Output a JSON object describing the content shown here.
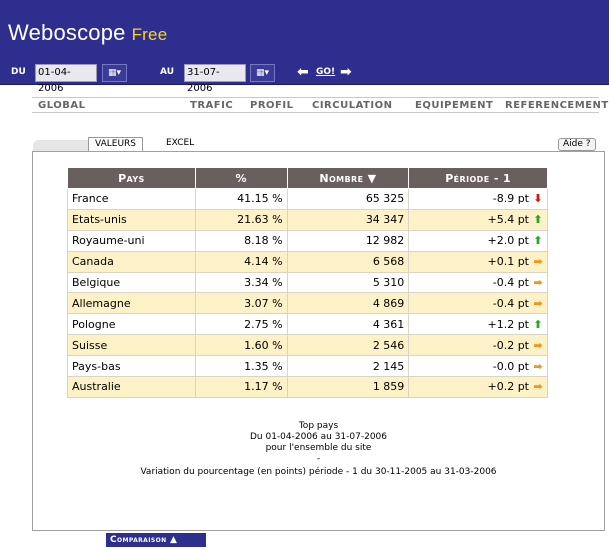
{
  "app": {
    "name": "Weboscope",
    "edition": "Free"
  },
  "dates": {
    "from_label": "DU",
    "from_value": "01-04-2006",
    "to_label": "AU",
    "to_value": "31-07-2006",
    "go_label": "GO!"
  },
  "nav": {
    "items": [
      "GLOBAL",
      "TRAFIC",
      "PROFIL",
      "CIRCULATION",
      "EQUIPEMENT",
      "REFERENCEMENT"
    ]
  },
  "tabs": {
    "valeurs": "VALEURS",
    "excel": "EXCEL",
    "help": "Aide ?"
  },
  "table": {
    "headers": [
      "Pays",
      "%",
      "Nombre ▼",
      "Période - 1"
    ],
    "rows": [
      {
        "pays": "France",
        "pct": "41.15 %",
        "nombre": "65 325",
        "periode": "-8.9 pt",
        "trend": "down"
      },
      {
        "pays": "Etats-unis",
        "pct": "21.63 %",
        "nombre": "34 347",
        "periode": "+5.4 pt",
        "trend": "up"
      },
      {
        "pays": "Royaume-uni",
        "pct": "8.18 %",
        "nombre": "12 982",
        "periode": "+2.0 pt",
        "trend": "up"
      },
      {
        "pays": "Canada",
        "pct": "4.14 %",
        "nombre": "6 568",
        "periode": "+0.1 pt",
        "trend": "flat"
      },
      {
        "pays": "Belgique",
        "pct": "3.34 %",
        "nombre": "5 310",
        "periode": "-0.4 pt",
        "trend": "flat"
      },
      {
        "pays": "Allemagne",
        "pct": "3.07 %",
        "nombre": "4 869",
        "periode": "-0.4 pt",
        "trend": "flat"
      },
      {
        "pays": "Pologne",
        "pct": "2.75 %",
        "nombre": "4 361",
        "periode": "+1.2 pt",
        "trend": "up"
      },
      {
        "pays": "Suisse",
        "pct": "1.60 %",
        "nombre": "2 546",
        "periode": "-0.2 pt",
        "trend": "flat"
      },
      {
        "pays": "Pays-bas",
        "pct": "1.35 %",
        "nombre": "2 145",
        "periode": "-0.0 pt",
        "trend": "flat"
      },
      {
        "pays": "Australie",
        "pct": "1.17 %",
        "nombre": "1 859",
        "periode": "+0.2 pt",
        "trend": "flat"
      }
    ]
  },
  "caption": {
    "title": "Top pays",
    "range": "Du 01-04-2006 au 31-07-2006",
    "scope": "pour l'ensemble du site",
    "sep": "-",
    "variation": "Variation du pourcentage (en points) période - 1 du 30-11-2005 au 31-03-2006"
  },
  "footer": {
    "compare_label": "Comparaison ▲"
  },
  "colors": {
    "header_bg": "#2e2e8e",
    "edition": "#ffd21f",
    "row_alt": "#fdf1c7",
    "table_head": "#6a5f5f",
    "trend_down": "#dd1111",
    "trend_up": "#22aa22",
    "trend_flat": "#f0951e"
  },
  "icons": {
    "calendar": "calendar-icon",
    "prev": "arrow-left-icon",
    "next": "arrow-right-icon"
  }
}
